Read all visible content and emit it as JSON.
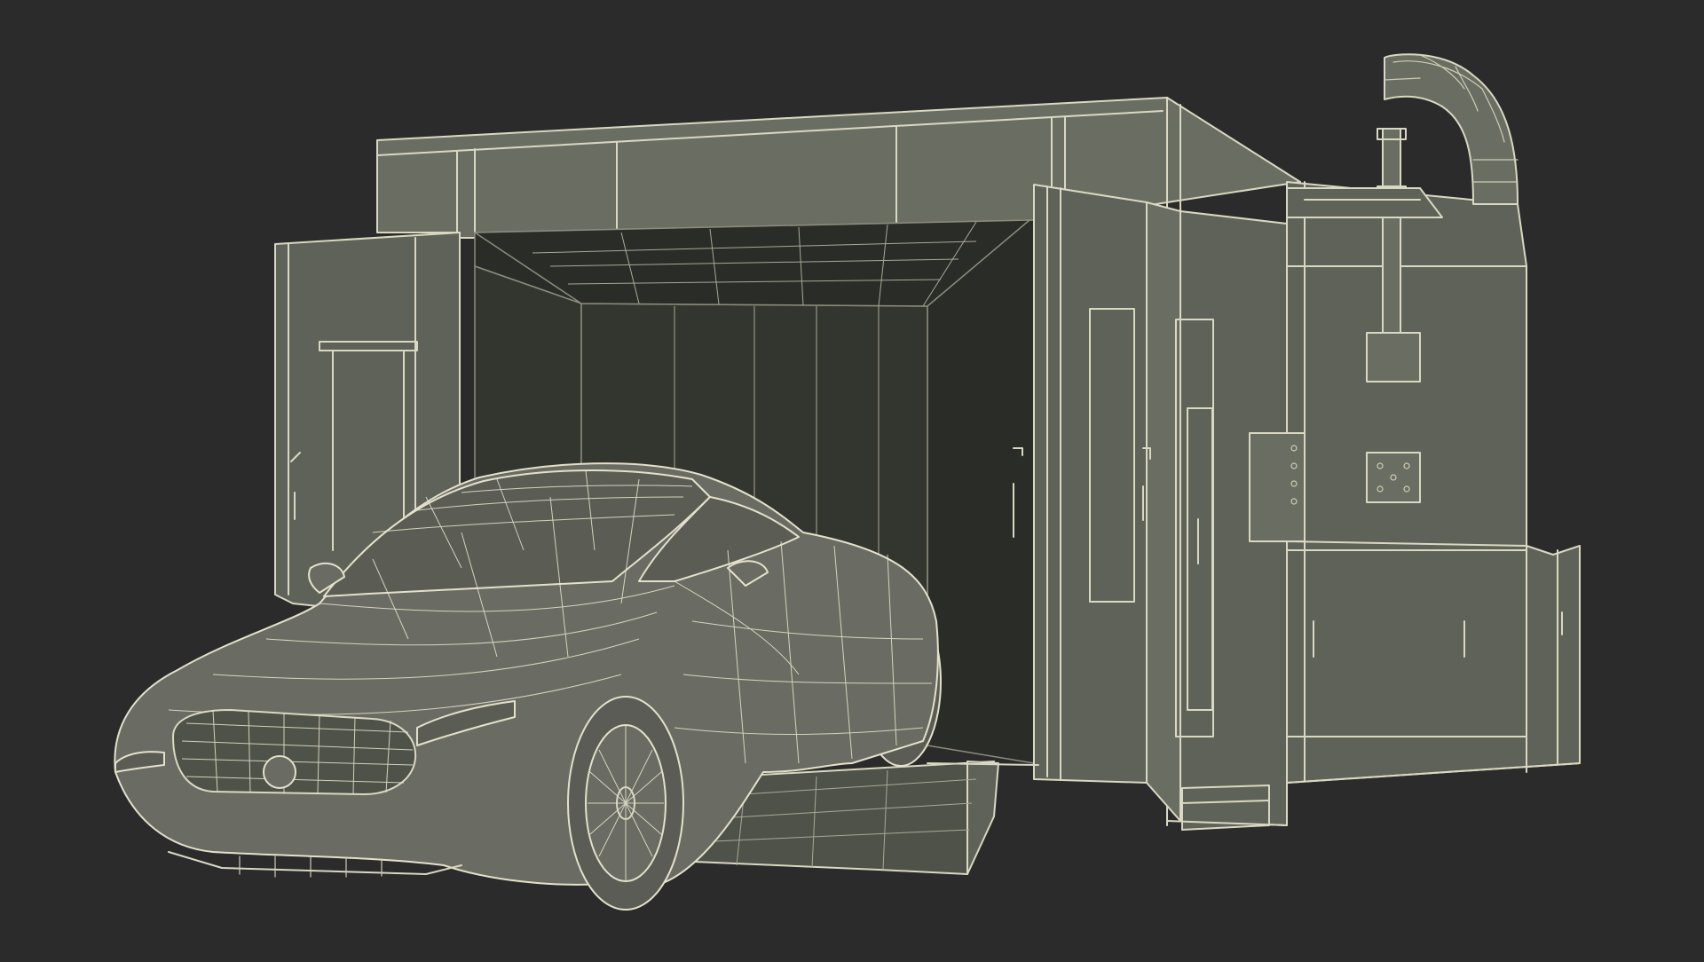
{
  "scene": {
    "subject": "",
    "background_color": "#2b2b2b",
    "wire_color": "#d9d8c2",
    "booth_fill_color": "#5f6258",
    "car_fill_color": "#6a6c63"
  }
}
